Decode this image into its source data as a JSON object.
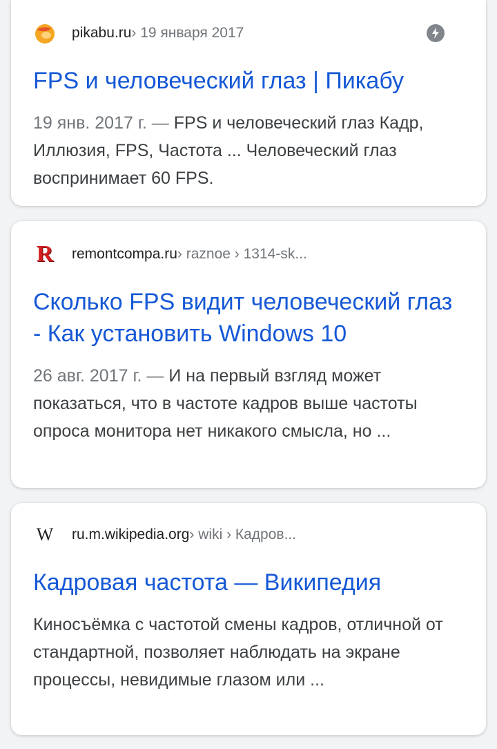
{
  "results": [
    {
      "favicon": "pikabu-logo-icon",
      "site": "pikabu.ru",
      "crumbs": " › 19 января 2017",
      "badge": "amp-lightning-icon",
      "title": "FPS и человеческий глаз | Пикабу",
      "date": "19 янв. 2017 г. — ",
      "snippet": "FPS и человеческий глаз Кадр, Иллюзия, FPS, Частота ... Человеческий глаз воспринимает 60 FPS."
    },
    {
      "favicon": "remontcompa-logo-icon",
      "favicon_letter": "R",
      "site": "remontcompa.ru",
      "crumbs": " › raznoe › 1314-sk...",
      "title": "Сколько FPS видит человеческий глаз - Как установить Windows 10",
      "date": "26 авг. 2017 г. — ",
      "snippet": "И на первый взгляд может показаться, что в частоте кадров выше частоты опроса монитора нет никакого смысла, но ..."
    },
    {
      "favicon": "wikipedia-logo-icon",
      "favicon_letter": "W",
      "site": "ru.m.wikipedia.org",
      "crumbs": " › wiki › Кадров...",
      "title": "Кадровая частота — Википедия",
      "snippet": "Киносъёмка с частотой смены кадров, отличной от стандартной, позволяет наблюдать на экране процессы, невидимые глазом или ..."
    }
  ],
  "colors": {
    "link": "#1558d6",
    "text": "#3c4043",
    "muted": "#70757a",
    "pikabu_orange": "#f5a623",
    "remont_red": "#d21f1f"
  }
}
